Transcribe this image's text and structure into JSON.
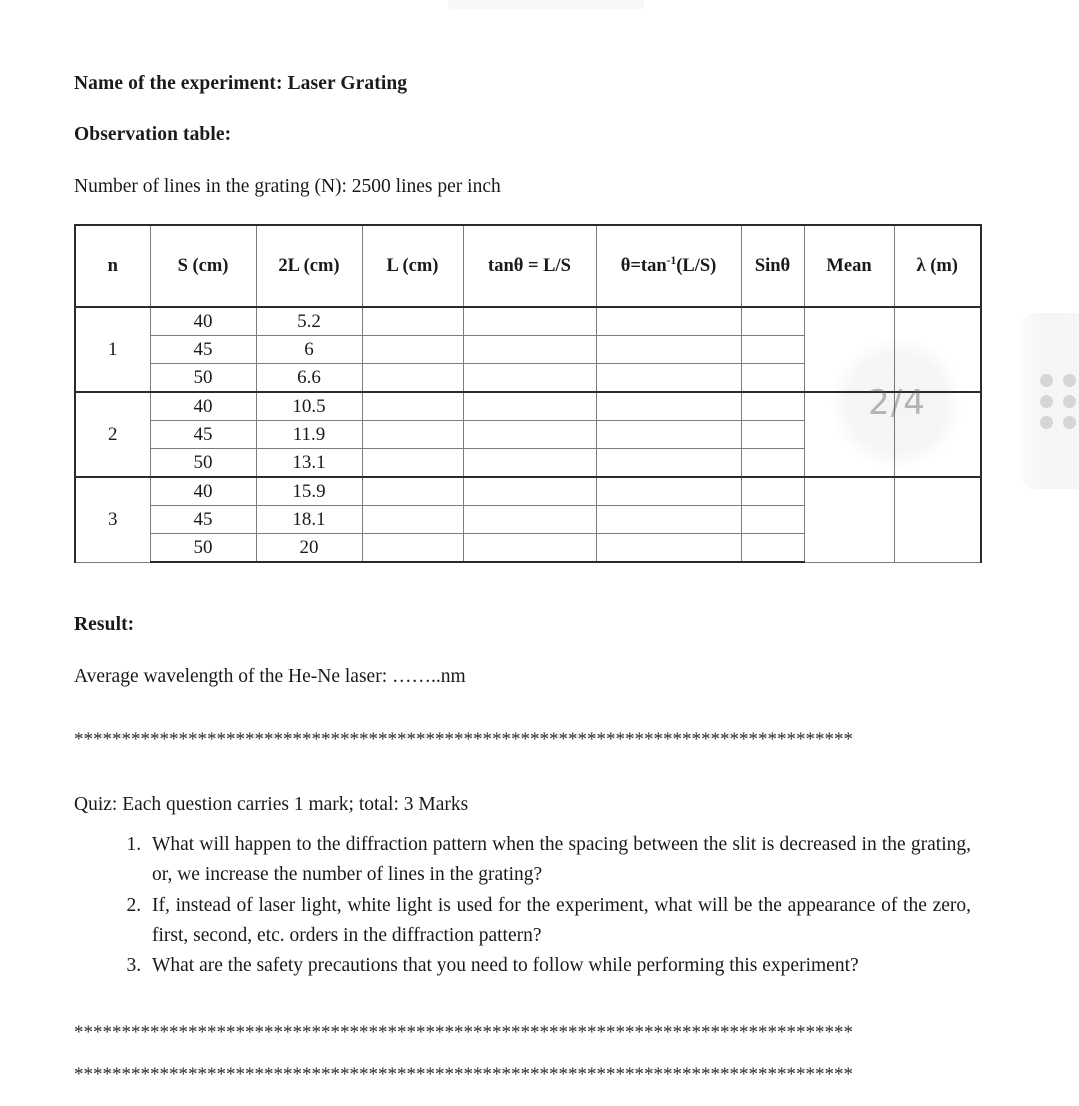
{
  "document": {
    "experiment_title": "Name of the experiment: Laser Grating",
    "observation_heading": "Observation table:",
    "grating_lines": "Number of lines in the grating (N): 2500 lines per inch",
    "result_heading": "Result:",
    "result_text": "Average wavelength of the He-Ne laser: ……..nm",
    "quiz_intro": "Quiz: Each question carries 1 mark; total: 3 Marks",
    "separator_top": "**********************************************************************************",
    "separator_bottom_1": "**********************************************************************************",
    "separator_bottom_2": "**********************************************************************************"
  },
  "table": {
    "headers": {
      "n": "n",
      "s_cm": "S (cm)",
      "two_l_cm": "2L (cm)",
      "l_cm": "L (cm)",
      "tan_theta": "tanθ = L/S",
      "theta": "θ=tan",
      "theta_sup": "-1",
      "theta_tail": "(L/S)",
      "sin_theta": "Sinθ",
      "mean": "Mean",
      "lambda_m": "λ (m)"
    },
    "groups": [
      {
        "n": "1",
        "rows": [
          {
            "s": "40",
            "two_l": "5.2",
            "l": "",
            "tan": "",
            "theta": "",
            "sin": ""
          },
          {
            "s": "45",
            "two_l": "6",
            "l": "",
            "tan": "",
            "theta": "",
            "sin": ""
          },
          {
            "s": "50",
            "two_l": "6.6",
            "l": "",
            "tan": "",
            "theta": "",
            "sin": ""
          }
        ],
        "mean": "",
        "lambda": ""
      },
      {
        "n": "2",
        "rows": [
          {
            "s": "40",
            "two_l": "10.5",
            "l": "",
            "tan": "",
            "theta": "",
            "sin": ""
          },
          {
            "s": "45",
            "two_l": "11.9",
            "l": "",
            "tan": "",
            "theta": "",
            "sin": ""
          },
          {
            "s": "50",
            "two_l": "13.1",
            "l": "",
            "tan": "",
            "theta": "",
            "sin": ""
          }
        ],
        "mean": "",
        "lambda": ""
      },
      {
        "n": "3",
        "rows": [
          {
            "s": "40",
            "two_l": "15.9",
            "l": "",
            "tan": "",
            "theta": "",
            "sin": ""
          },
          {
            "s": "45",
            "two_l": "18.1",
            "l": "",
            "tan": "",
            "theta": "",
            "sin": ""
          },
          {
            "s": "50",
            "two_l": "20",
            "l": "",
            "tan": "",
            "theta": "",
            "sin": ""
          }
        ],
        "mean": "",
        "lambda": ""
      }
    ]
  },
  "quiz": {
    "questions": [
      "What will happen to the diffraction pattern when the spacing between the slit is decreased in the grating, or, we increase the number of lines in the grating?",
      "If, instead of laser light, white light is used for the experiment, what will be the appearance of the zero, first, second, etc. orders in the diffraction pattern?",
      "What are the safety precautions that you need to follow while performing this experiment?"
    ]
  },
  "overlay": {
    "page_indicator": "2/4",
    "handle_icon": "drag-dots-icon"
  },
  "colors": {
    "text": "#1a1a1a",
    "table_border": "#7c7c7c",
    "table_border_strong": "#2b2b2b",
    "overlay_text": "#5a5a5a",
    "handle_dot": "#d6d6d6",
    "page_background": "#ffffff"
  }
}
